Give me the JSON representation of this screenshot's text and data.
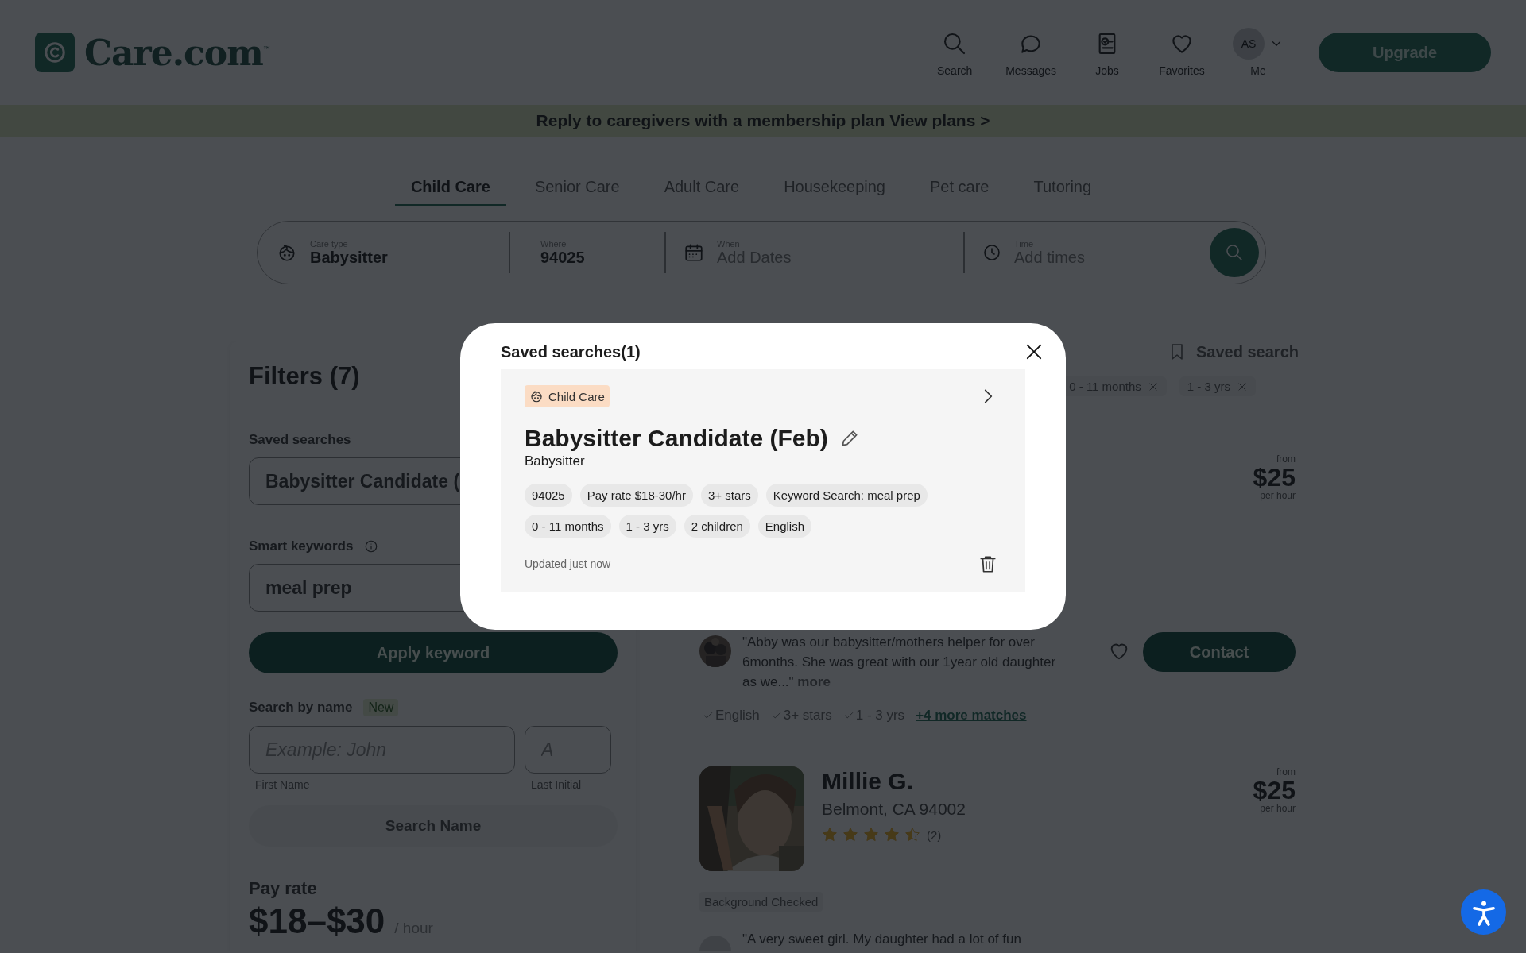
{
  "header": {
    "logo": "Care.com$^{™}$",
    "nav": [
      {
        "kind": "search",
        "label": "Search"
      },
      {
        "kind": "messages",
        "label": "Messages"
      },
      {
        "kind": "jobs",
        "label": "Jobs"
      },
      {
        "kind": "favorites",
        "label": "Favorites"
      },
      {
        "kind": "avatar",
        "initials": "AS",
        "label": "Me"
      }
    ],
    "upgrade": "Upgrade"
  },
  "banner": "Reply to caregivers with a membership plan View plans >",
  "care_tabs": [
    {
      "label": "Child Care",
      "selected": true
    },
    {
      "label": "Senior Care",
      "selected": false
    },
    {
      "label": "Adult Care",
      "selected": false
    },
    {
      "label": "Housekeeping",
      "selected": false
    },
    {
      "label": "Pet care",
      "selected": false
    },
    {
      "label": "Tutoring",
      "selected": false
    }
  ],
  "search_bar": [
    {
      "kind": "care",
      "label": "Care type",
      "value": "Babysitter"
    },
    {
      "kind": "where",
      "label": "Where",
      "value": "94025"
    },
    {
      "kind": "when",
      "label": "When",
      "placeholder": "Add Dates"
    },
    {
      "kind": "time",
      "label": "Time",
      "placeholder": "Add times"
    }
  ],
  "filters": {
    "title": "Filters (7)",
    "saved_label": "Saved searches",
    "saved_value": "Babysitter Candidate (",
    "keywords_label": "Smart keywords",
    "keywords_value": "meal prep",
    "apply": "Apply keyword",
    "name_label": "Search by name",
    "name_badge": "New",
    "first_placeholder": "Example: John",
    "last_placeholder": "A",
    "first_caption": "First Name",
    "last_caption": "Last Initial",
    "search_name": {
      "label": "Search Name",
      "disabled": true
    },
    "pay_label": "Pay rate",
    "pay_value": "$18–$30",
    "pay_unit": "/ hour"
  },
  "results": {
    "saved_search": "Saved search",
    "active_filters": [
      "0 - 11 months",
      "1 - 3 yrs"
    ],
    "cards": [
      {
        "kind": "review_only",
        "from": "from",
        "price": "$25",
        "per": "per hour",
        "review": "\"Abby was our babysitter/mothers helper for over 6months. She was great with our 1year old daughter as we...\"",
        "more": "more",
        "matches": [
          "English",
          "3+ stars",
          "1 - 3 yrs"
        ],
        "more_matches": "+4 more matches",
        "contact": "Contact"
      },
      {
        "kind": "profile",
        "name": "Millie G.",
        "location": "Belmont, CA 94002",
        "stars": 4.5,
        "review_count": "(2)",
        "from": "from",
        "price": "$25",
        "per": "per hour",
        "badge": "Background Checked",
        "review": "\"A very sweet girl. My daughter had a lot of fun"
      }
    ]
  },
  "modal": {
    "title": "Saved searches(1)",
    "card": {
      "tag": "Child Care",
      "name": "Babysitter Candidate (Feb)",
      "type": "Babysitter",
      "chips": [
        [
          "94025",
          "Pay rate $18-30/hr",
          "3+ stars",
          "Keyword Search: meal prep"
        ],
        [
          "0 - 11 months",
          "1 - 3 yrs",
          "2 children",
          "English"
        ]
      ],
      "updated": "Updated just now"
    }
  }
}
